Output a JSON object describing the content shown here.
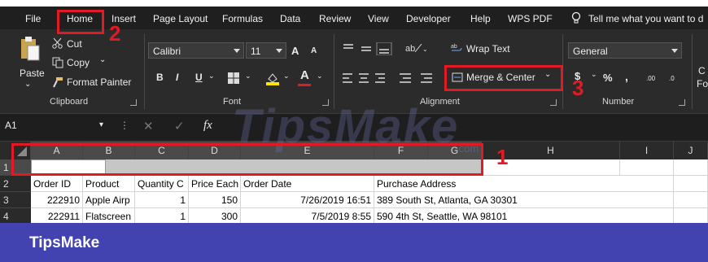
{
  "menubar": {
    "tabs": [
      "File",
      "Home",
      "Insert",
      "Page Layout",
      "Formulas",
      "Data",
      "Review",
      "View",
      "Developer",
      "Help",
      "WPS PDF"
    ],
    "tell_me": "Tell me what you want to d"
  },
  "clipboard": {
    "paste": "Paste",
    "cut": "Cut",
    "copy": "Copy",
    "format_painter": "Format Painter",
    "label": "Clipboard"
  },
  "font": {
    "name": "Calibri",
    "size": "11",
    "grow": "A",
    "shrink": "A",
    "bold": "B",
    "italic": "I",
    "underline": "U",
    "font_color_letter": "A",
    "label": "Font"
  },
  "alignment": {
    "wrap_text": "Wrap Text",
    "merge_center": "Merge & Center",
    "label": "Alignment"
  },
  "number": {
    "format": "General",
    "currency": "$",
    "percent": "%",
    "comma": ",",
    "inc_dec": ".00",
    "dec_dec": ".0",
    "label": "Number"
  },
  "styles_partial": {
    "top": "C",
    "bottom": "Fo"
  },
  "formula_bar": {
    "name_box": "A1",
    "fx": "fx"
  },
  "grid": {
    "columns": [
      "A",
      "B",
      "C",
      "D",
      "E",
      "F",
      "G",
      "H",
      "I",
      "J"
    ],
    "rows": [
      "1",
      "2",
      "3",
      "4"
    ],
    "headers": [
      "Order ID",
      "Product",
      "Quantity C",
      "Price Each",
      "Order Date",
      "Purchase Address"
    ],
    "data": [
      [
        "222910",
        "Apple Airp",
        "1",
        "150",
        "7/26/2019 16:51",
        "389 South St, Atlanta, GA 30301"
      ],
      [
        "222911",
        "Flatscreen",
        "1",
        "300",
        "7/5/2019 8:55",
        "590 4th St, Seattle, WA 98101"
      ]
    ]
  },
  "annotations": {
    "n1": "1",
    "n2": "2",
    "n3": "3"
  },
  "watermark": {
    "text": "TipsMake",
    "com": ".com"
  },
  "footer": {
    "brand": "TipsMake"
  },
  "colors": {
    "annotation_red": "#e01b24",
    "footer_blue": "#4242b0",
    "ribbon_dark": "#2b2b2b"
  }
}
